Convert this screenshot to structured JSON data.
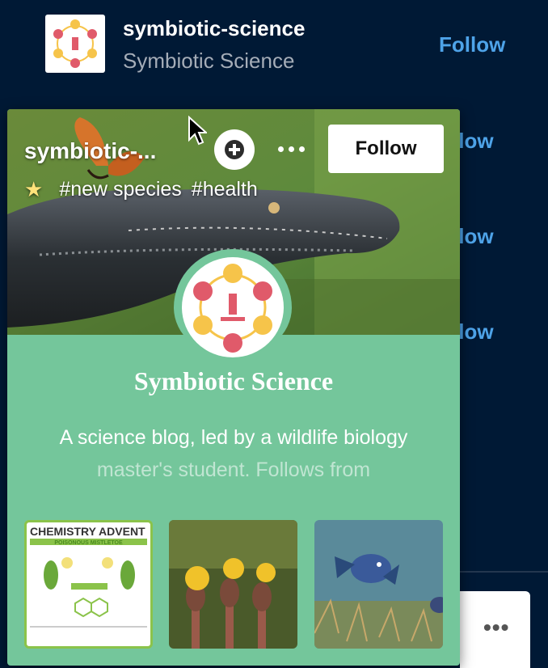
{
  "list": {
    "first_row": {
      "username": "symbiotic-science",
      "title": "Symbiotic Science",
      "follow_label": "Follow"
    },
    "partial_follow_labels": [
      "llow",
      "llow",
      "llow"
    ]
  },
  "popover": {
    "username": "symbiotic-...",
    "follow_label": "Follow",
    "tags": [
      "#new species",
      "#health"
    ],
    "blog_title": "Symbiotic Science",
    "description_line1": "A science blog, led by a wildlife biology",
    "description_line2": "master's student. Follows from",
    "thumbnails": [
      {
        "title": "CHEMISTRY ADVENT",
        "subtitle": "POISONOUS MISTLETOE",
        "name": "chemistry-advent-thumbnail"
      },
      {
        "name": "flowers-thumbnail"
      },
      {
        "name": "fish-thumbnail"
      }
    ]
  },
  "icons": {
    "plus": "plus-circle-icon",
    "more": "more-dots-icon",
    "star": "sparkle-icon",
    "cursor": "mouse-cursor-icon"
  },
  "colors": {
    "background": "#001935",
    "accent_link": "#4ea3e8",
    "popover_bg": "#74c69b"
  }
}
